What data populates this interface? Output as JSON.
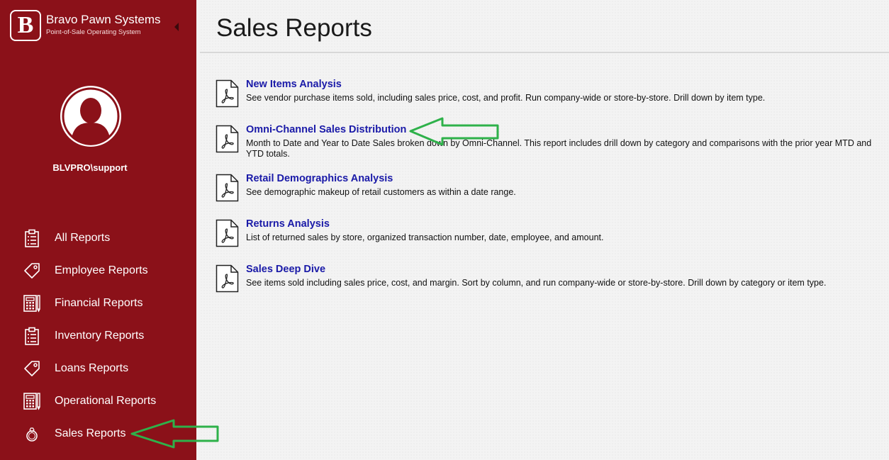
{
  "app": {
    "brand_name": "Bravo Pawn Systems",
    "brand_tagline": "Point-of-Sale Operating System",
    "brand_mark": "B"
  },
  "user": {
    "name": "BLVPRO\\support"
  },
  "sidebar": {
    "items": [
      {
        "label": "All Reports",
        "icon": "clipboard-icon"
      },
      {
        "label": "Employee Reports",
        "icon": "tag-icon"
      },
      {
        "label": "Financial Reports",
        "icon": "calculator-icon"
      },
      {
        "label": "Inventory Reports",
        "icon": "clipboard-icon"
      },
      {
        "label": "Loans Reports",
        "icon": "tag-icon"
      },
      {
        "label": "Operational Reports",
        "icon": "calculator-icon"
      },
      {
        "label": "Sales Reports",
        "icon": "ring-icon"
      }
    ]
  },
  "main": {
    "title": "Sales Reports",
    "reports": [
      {
        "title": "New Items Analysis",
        "description": "See vendor purchase items sold, including sales price, cost, and profit. Run company-wide or store-by-store. Drill down by item type."
      },
      {
        "title": "Omni-Channel Sales Distribution",
        "description": "Month to Date and Year to Date Sales broken down by Omni-Channel. This report includes drill down by category and comparisons with the prior year MTD and YTD totals."
      },
      {
        "title": "Retail Demographics Analysis",
        "description": "See demographic makeup of retail customers as within a date range."
      },
      {
        "title": "Returns Analysis",
        "description": "List of returned sales by store, organized transaction number, date, employee, and amount."
      },
      {
        "title": "Sales Deep Dive",
        "description": "See items sold including sales price, cost, and margin. Sort by column, and run company-wide or store-by-store. Drill down by category or item type."
      }
    ]
  },
  "colors": {
    "sidebar_bg": "#8b1119",
    "link": "#1a1aa8",
    "annotation_arrow": "#2eb14a"
  }
}
